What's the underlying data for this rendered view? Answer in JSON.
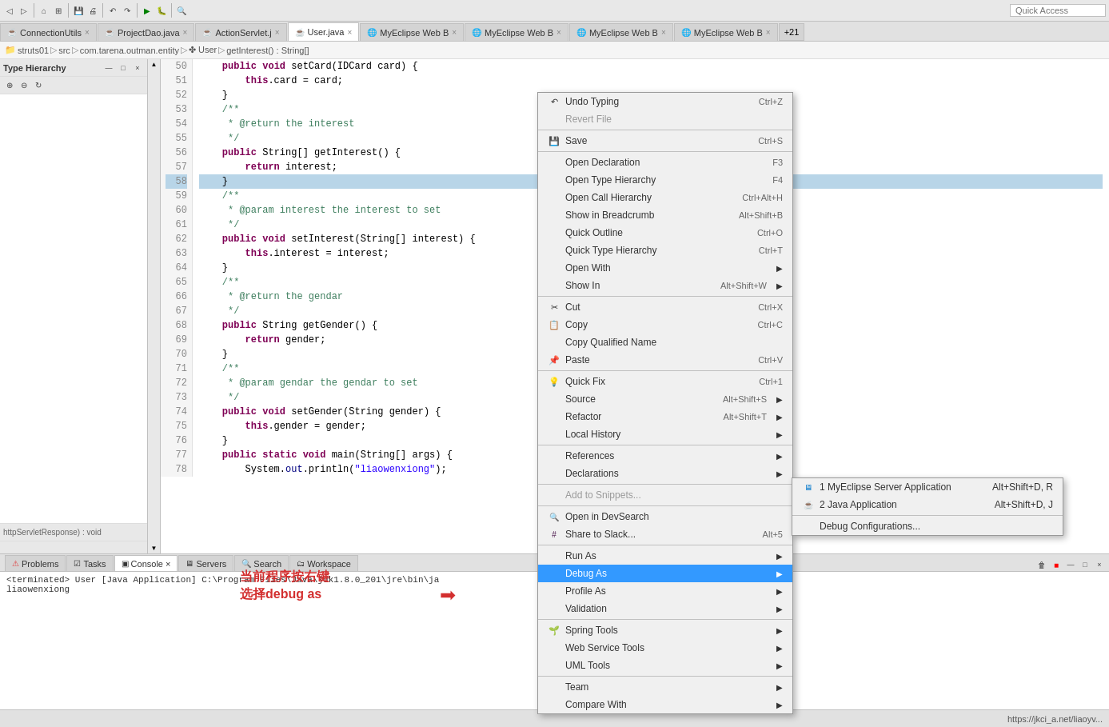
{
  "toolbar": {
    "quick_access_placeholder": "Quick Access"
  },
  "tabs": [
    {
      "label": "ConnectionUtils",
      "icon": "java",
      "active": false
    },
    {
      "label": "ProjectDao.java",
      "icon": "java",
      "active": false
    },
    {
      "label": "ActionServlet.j",
      "icon": "java",
      "active": false
    },
    {
      "label": "User.java",
      "icon": "java",
      "active": true
    },
    {
      "label": "MyEclipse Web B",
      "icon": "web",
      "active": false
    },
    {
      "label": "MyEclipse Web B",
      "icon": "web",
      "active": false
    },
    {
      "label": "MyEclipse Web B",
      "icon": "web",
      "active": false
    },
    {
      "label": "MyEclipse Web B",
      "icon": "web",
      "active": false
    }
  ],
  "tab_overflow": "+21",
  "breadcrumb": {
    "parts": [
      "struts01",
      ">",
      "src",
      ">",
      "com.tarena.outman.entity",
      ">",
      "User",
      ">",
      "getInterest() : String[]"
    ]
  },
  "left_panel": {
    "title": "Type Hierarchy"
  },
  "code": {
    "lines": [
      {
        "num": "50",
        "text": "    public void setCard(IDCard card) {",
        "highlight": false
      },
      {
        "num": "51",
        "text": "        this.card = card;",
        "highlight": false
      },
      {
        "num": "52",
        "text": "    }",
        "highlight": false
      },
      {
        "num": "53",
        "text": "    /**",
        "highlight": false
      },
      {
        "num": "54",
        "text": "     * @return the interest",
        "highlight": false
      },
      {
        "num": "55",
        "text": "     */",
        "highlight": false
      },
      {
        "num": "56",
        "text": "    public String[] getInterest() {",
        "highlight": false
      },
      {
        "num": "57",
        "text": "        return interest;",
        "highlight": false
      },
      {
        "num": "58",
        "text": "    }",
        "highlight": true
      },
      {
        "num": "59",
        "text": "    /**",
        "highlight": false
      },
      {
        "num": "60",
        "text": "     * @param interest the interest to set",
        "highlight": false
      },
      {
        "num": "61",
        "text": "     */",
        "highlight": false
      },
      {
        "num": "62",
        "text": "    public void setInterest(String[] interest) {",
        "highlight": false
      },
      {
        "num": "63",
        "text": "        this.interest = interest;",
        "highlight": false
      },
      {
        "num": "64",
        "text": "    }",
        "highlight": false
      },
      {
        "num": "65",
        "text": "    /**",
        "highlight": false
      },
      {
        "num": "66",
        "text": "     * @return the gendar",
        "highlight": false
      },
      {
        "num": "67",
        "text": "     */",
        "highlight": false
      },
      {
        "num": "68",
        "text": "    public String getGender() {",
        "highlight": false
      },
      {
        "num": "69",
        "text": "        return gender;",
        "highlight": false
      },
      {
        "num": "70",
        "text": "    }",
        "highlight": false
      },
      {
        "num": "71",
        "text": "    /**",
        "highlight": false
      },
      {
        "num": "72",
        "text": "     * @param gendar the gendar to set",
        "highlight": false
      },
      {
        "num": "73",
        "text": "     */",
        "highlight": false
      },
      {
        "num": "74",
        "text": "    public void setGender(String gender) {",
        "highlight": false
      },
      {
        "num": "75",
        "text": "        this.gender = gender;",
        "highlight": false
      },
      {
        "num": "76",
        "text": "    }",
        "highlight": false
      },
      {
        "num": "77",
        "text": "    public static void main(String[] args) {",
        "highlight": false
      },
      {
        "num": "78",
        "text": "        System.out.println(\"liaowenxiong\");",
        "highlight": false
      }
    ]
  },
  "bottom_tabs": [
    {
      "label": "Problems",
      "active": false
    },
    {
      "label": "Tasks",
      "active": false
    },
    {
      "label": "Console",
      "active": true
    },
    {
      "label": "Servers",
      "active": false
    },
    {
      "label": "Search",
      "active": false
    },
    {
      "label": "Workspace",
      "active": false
    }
  ],
  "console_content": [
    "<terminated> User [Java Application] C:\\Program Files\\Java\\jdk1.8.0_201\\jre\\bin\\ja",
    "liaowenxiong"
  ],
  "context_menu": {
    "items": [
      {
        "label": "Undo Typing",
        "shortcut": "Ctrl+Z",
        "icon": "undo",
        "disabled": false,
        "has_sub": false
      },
      {
        "label": "Revert File",
        "shortcut": "",
        "icon": "",
        "disabled": true,
        "has_sub": false
      },
      {
        "sep": true
      },
      {
        "label": "Save",
        "shortcut": "Ctrl+S",
        "icon": "save",
        "disabled": false,
        "has_sub": false
      },
      {
        "sep": true
      },
      {
        "label": "Open Declaration",
        "shortcut": "F3",
        "icon": "",
        "disabled": false,
        "has_sub": false
      },
      {
        "label": "Open Type Hierarchy",
        "shortcut": "F4",
        "icon": "",
        "disabled": false,
        "has_sub": false
      },
      {
        "label": "Open Call Hierarchy",
        "shortcut": "Ctrl+Alt+H",
        "icon": "",
        "disabled": false,
        "has_sub": false
      },
      {
        "label": "Show in Breadcrumb",
        "shortcut": "Alt+Shift+B",
        "icon": "",
        "disabled": false,
        "has_sub": false
      },
      {
        "label": "Quick Outline",
        "shortcut": "Ctrl+O",
        "icon": "",
        "disabled": false,
        "has_sub": false
      },
      {
        "label": "Quick Type Hierarchy",
        "shortcut": "Ctrl+T",
        "icon": "",
        "disabled": false,
        "has_sub": false
      },
      {
        "label": "Open With",
        "shortcut": "",
        "icon": "",
        "disabled": false,
        "has_sub": true
      },
      {
        "label": "Show In",
        "shortcut": "Alt+Shift+W",
        "icon": "",
        "disabled": false,
        "has_sub": true
      },
      {
        "sep": true
      },
      {
        "label": "Cut",
        "shortcut": "Ctrl+X",
        "icon": "",
        "disabled": false,
        "has_sub": false
      },
      {
        "label": "Copy",
        "shortcut": "Ctrl+C",
        "icon": "",
        "disabled": false,
        "has_sub": false
      },
      {
        "label": "Copy Qualified Name",
        "shortcut": "",
        "icon": "",
        "disabled": false,
        "has_sub": false
      },
      {
        "label": "Paste",
        "shortcut": "Ctrl+V",
        "icon": "",
        "disabled": false,
        "has_sub": false
      },
      {
        "sep": true
      },
      {
        "label": "Quick Fix",
        "shortcut": "Ctrl+1",
        "icon": "",
        "disabled": false,
        "has_sub": false
      },
      {
        "label": "Source",
        "shortcut": "Alt+Shift+S",
        "icon": "",
        "disabled": false,
        "has_sub": true
      },
      {
        "label": "Refactor",
        "shortcut": "Alt+Shift+T",
        "icon": "",
        "disabled": false,
        "has_sub": true
      },
      {
        "label": "Local History",
        "shortcut": "",
        "icon": "",
        "disabled": false,
        "has_sub": true
      },
      {
        "sep": true
      },
      {
        "label": "References",
        "shortcut": "",
        "icon": "",
        "disabled": false,
        "has_sub": true
      },
      {
        "label": "Declarations",
        "shortcut": "",
        "icon": "",
        "disabled": false,
        "has_sub": true
      },
      {
        "sep": true
      },
      {
        "label": "Add to Snippets...",
        "shortcut": "",
        "icon": "",
        "disabled": true,
        "has_sub": false
      },
      {
        "sep": true
      },
      {
        "label": "Open in DevSearch",
        "shortcut": "",
        "icon": "devsearch",
        "disabled": false,
        "has_sub": false
      },
      {
        "label": "Share to Slack...",
        "shortcut": "Alt+5",
        "icon": "slack",
        "disabled": false,
        "has_sub": false
      },
      {
        "sep": true
      },
      {
        "label": "Run As",
        "shortcut": "",
        "icon": "",
        "disabled": false,
        "has_sub": true
      },
      {
        "label": "Debug As",
        "shortcut": "",
        "icon": "",
        "disabled": false,
        "has_sub": true,
        "highlighted": true
      },
      {
        "label": "Profile As",
        "shortcut": "",
        "icon": "",
        "disabled": false,
        "has_sub": true
      },
      {
        "label": "Validation",
        "shortcut": "",
        "icon": "",
        "disabled": false,
        "has_sub": true
      },
      {
        "sep": true
      },
      {
        "label": "Spring Tools",
        "shortcut": "",
        "icon": "spring",
        "disabled": false,
        "has_sub": true
      },
      {
        "label": "Web Service Tools",
        "shortcut": "",
        "icon": "",
        "disabled": false,
        "has_sub": true
      },
      {
        "label": "UML Tools",
        "shortcut": "",
        "icon": "",
        "disabled": false,
        "has_sub": true
      },
      {
        "sep": true
      },
      {
        "label": "Team",
        "shortcut": "",
        "icon": "",
        "disabled": false,
        "has_sub": true
      },
      {
        "label": "Compare With",
        "shortcut": "",
        "icon": "",
        "disabled": false,
        "has_sub": true
      }
    ]
  },
  "submenu": {
    "items": [
      {
        "label": "1 MyEclipse Server Application",
        "shortcut": "Alt+Shift+D, R"
      },
      {
        "label": "2 Java Application",
        "shortcut": "Alt+Shift+D, J"
      },
      {
        "sep": true
      },
      {
        "label": "Debug Configurations...",
        "shortcut": ""
      }
    ]
  },
  "annotation": {
    "line1": "当前程序按右键",
    "line2": "选择debug as"
  },
  "status_bar": {
    "text": "https://jkci_a.net/liaoyv..."
  }
}
